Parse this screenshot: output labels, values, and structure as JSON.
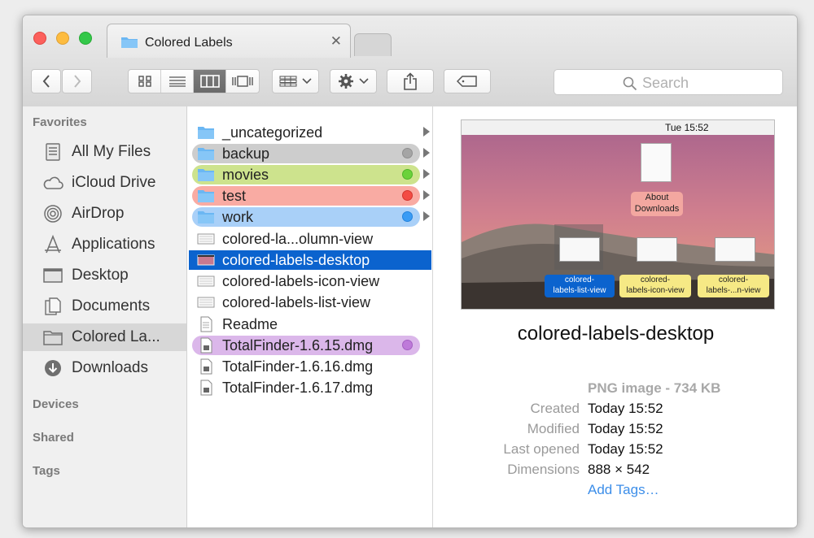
{
  "tab": {
    "title": "Colored Labels"
  },
  "search": {
    "placeholder": "Search"
  },
  "sidebar": {
    "favorites_label": "Favorites",
    "devices_label": "Devices",
    "shared_label": "Shared",
    "tags_label": "Tags",
    "items": [
      {
        "label": "All My Files",
        "icon": "all-files-icon"
      },
      {
        "label": "iCloud Drive",
        "icon": "cloud-icon"
      },
      {
        "label": "AirDrop",
        "icon": "airdrop-icon"
      },
      {
        "label": "Applications",
        "icon": "applications-icon"
      },
      {
        "label": "Desktop",
        "icon": "desktop-icon"
      },
      {
        "label": "Documents",
        "icon": "documents-icon"
      },
      {
        "label": "Colored La...",
        "icon": "folder-icon"
      },
      {
        "label": "Downloads",
        "icon": "downloads-icon"
      }
    ]
  },
  "column": {
    "rows": [
      {
        "label": "_uncategorized",
        "kind": "folder"
      },
      {
        "label": "backup",
        "kind": "folder",
        "tag": "gray"
      },
      {
        "label": "movies",
        "kind": "folder",
        "tag": "green"
      },
      {
        "label": "test",
        "kind": "folder",
        "tag": "red"
      },
      {
        "label": "work",
        "kind": "folder",
        "tag": "blue"
      },
      {
        "label": "colored-la...olumn-view",
        "kind": "image"
      },
      {
        "label": "colored-labels-desktop",
        "kind": "image"
      },
      {
        "label": "colored-labels-icon-view",
        "kind": "image"
      },
      {
        "label": "colored-labels-list-view",
        "kind": "image"
      },
      {
        "label": "Readme",
        "kind": "document"
      },
      {
        "label": "TotalFinder-1.6.15.dmg",
        "kind": "disk",
        "tag": "purple"
      },
      {
        "label": "TotalFinder-1.6.16.dmg",
        "kind": "disk"
      },
      {
        "label": "TotalFinder-1.6.17.dmg",
        "kind": "disk"
      }
    ]
  },
  "preview": {
    "menubar_time": "Tue 15:52",
    "desktop_labels": {
      "about": "About",
      "downloads": "Downloads",
      "list_view_1": "colored-",
      "list_view_2": "labels-list-view",
      "icon_view_1": "colored-",
      "icon_view_2": "labels-icon-view",
      "column_view_1": "colored-",
      "column_view_2": "labels-...n-view"
    },
    "name": "colored-labels-desktop",
    "type": "PNG image - 734 KB",
    "created_key": "Created",
    "created_val": "Today 15:52",
    "modified_key": "Modified",
    "modified_val": "Today 15:52",
    "opened_key": "Last opened",
    "opened_val": "Today 15:52",
    "dimensions_key": "Dimensions",
    "dimensions_val": "888 × 542",
    "add_tags": "Add Tags…"
  },
  "colors": {
    "selection": "#0b63ce",
    "tag_gray": "#cdcdcd",
    "tag_gray_dot": "#a5a5a5",
    "tag_green": "#cde38d",
    "tag_green_dot": "#6bd23b",
    "tag_red": "#f9aba3",
    "tag_red_dot": "#f34c44",
    "tag_blue": "#a9d0f8",
    "tag_blue_dot": "#3a9cf5",
    "tag_purple": "#dbb7ea",
    "tag_purple_dot": "#be7ad9"
  }
}
